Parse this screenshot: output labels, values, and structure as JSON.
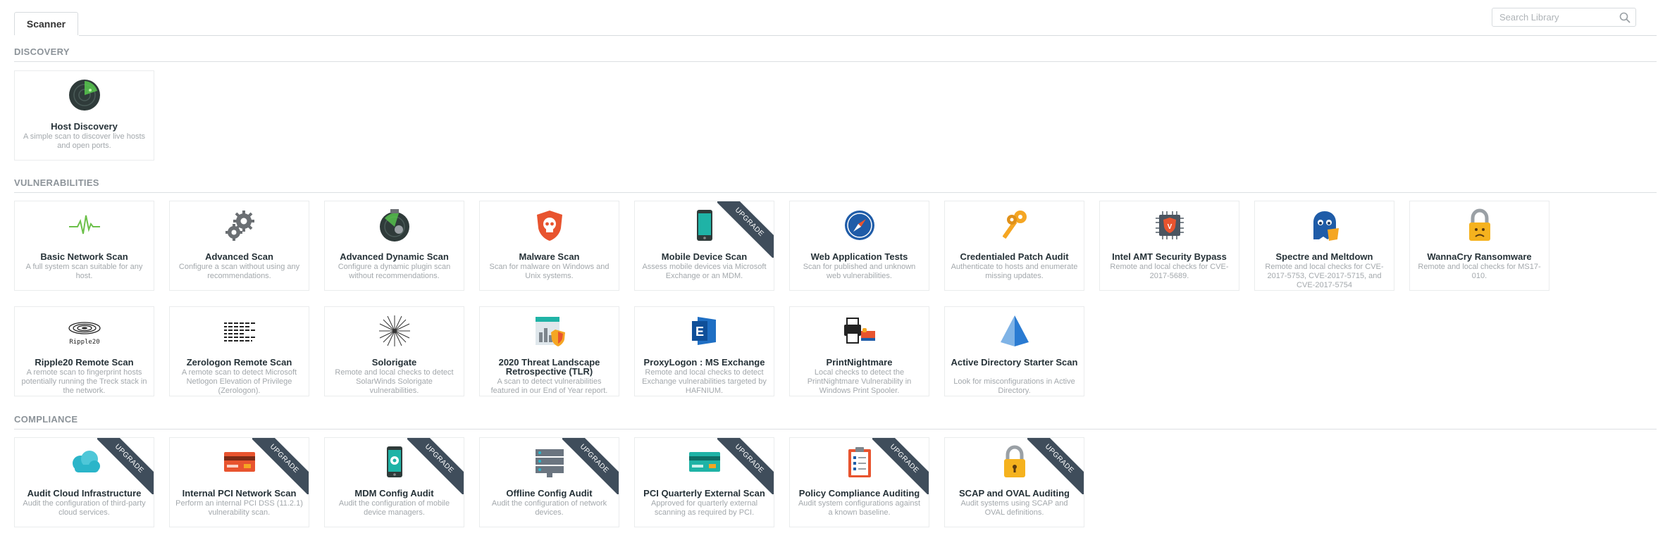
{
  "tabs": [
    {
      "label": "Scanner"
    }
  ],
  "search": {
    "placeholder": "Search Library"
  },
  "sections": {
    "discovery": "DISCOVERY",
    "vulnerabilities": "VULNERABILITIES",
    "compliance": "COMPLIANCE"
  },
  "upgrade_label": "UPGRADE",
  "cards": {
    "host_discovery": {
      "name": "Host Discovery",
      "desc": "A simple scan to discover live hosts and open ports.",
      "icon": "radar-icon"
    },
    "basic_network": {
      "name": "Basic Network Scan",
      "desc": "A full system scan suitable for any host.",
      "icon": "pulse-icon"
    },
    "advanced": {
      "name": "Advanced Scan",
      "desc": "Configure a scan without using any recommendations.",
      "icon": "gears-icon"
    },
    "advanced_dynamic": {
      "name": "Advanced Dynamic Scan",
      "desc": "Configure a dynamic plugin scan without recommendations.",
      "icon": "radar-gear-icon"
    },
    "malware": {
      "name": "Malware Scan",
      "desc": "Scan for malware on Windows and Unix systems.",
      "icon": "skull-shield-icon"
    },
    "mobile_device": {
      "name": "Mobile Device Scan",
      "desc": "Assess mobile devices via Microsoft Exchange or an MDM.",
      "icon": "phone-icon",
      "upgrade": true
    },
    "web_app": {
      "name": "Web Application Tests",
      "desc": "Scan for published and unknown web vulnerabilities.",
      "icon": "compass-icon"
    },
    "credentialed_patch": {
      "name": "Credentialed Patch Audit",
      "desc": "Authenticate to hosts and enumerate missing updates.",
      "icon": "keys-icon"
    },
    "intel_amt": {
      "name": "Intel AMT Security Bypass",
      "desc": "Remote and local checks for CVE-2017-5689.",
      "icon": "chip-icon"
    },
    "spectre": {
      "name": "Spectre and Meltdown",
      "desc": "Remote and local checks for CVE-2017-5753, CVE-2017-5715, and CVE-2017-5754",
      "icon": "ghost-icon"
    },
    "wannacry": {
      "name": "WannaCry Ransomware",
      "desc": "Remote and local checks for MS17-010.",
      "icon": "padlock-sad-icon"
    },
    "ripple20": {
      "name": "Ripple20 Remote Scan",
      "desc": "A remote scan to fingerprint hosts potentially running the Treck stack in the network.",
      "icon": "ripple20-logo-icon",
      "icon_text": "Ripple20"
    },
    "zerologon": {
      "name": "Zerologon Remote Scan",
      "desc": "A remote scan to detect Microsoft Netlogon Elevation of Privilege (Zerologon).",
      "icon": "zerologon-logo-icon"
    },
    "solorigate": {
      "name": "Solorigate",
      "desc": "Remote and local checks to detect SolarWinds Solorigate vulnerabilities.",
      "icon": "starburst-icon"
    },
    "tlr2020": {
      "name": "2020 Threat Landscape Retrospective (TLR)",
      "desc": "A scan to detect vulnerabilities featured in our End of Year report.",
      "icon": "report-shield-icon"
    },
    "proxylogon": {
      "name": "ProxyLogon : MS Exchange",
      "desc": "Remote and local checks to detect Exchange vulnerabilities targeted by HAFNIUM.",
      "icon": "exchange-icon"
    },
    "printnightmare": {
      "name": "PrintNightmare",
      "desc": "Local checks to detect the PrintNightmare Vulnerability in Windows Print Spooler.",
      "icon": "printer-bed-icon"
    },
    "active_directory": {
      "name": "Active Directory Starter Scan",
      "desc": "Look for misconfigurations in Active Directory.",
      "icon": "pyramid-icon"
    },
    "audit_cloud": {
      "name": "Audit Cloud Infrastructure",
      "desc": "Audit the configuration of third-party cloud services.",
      "icon": "cloud-icon",
      "upgrade": true
    },
    "internal_pci": {
      "name": "Internal PCI Network Scan",
      "desc": "Perform an internal PCI DSS (11.2.1) vulnerability scan.",
      "icon": "credit-card-icon",
      "upgrade": true
    },
    "mdm_config": {
      "name": "MDM Config Audit",
      "desc": "Audit the configuration of mobile device managers.",
      "icon": "phone-gear-icon",
      "upgrade": true
    },
    "offline_config": {
      "name": "Offline Config Audit",
      "desc": "Audit the configuration of network devices.",
      "icon": "server-icon",
      "upgrade": true
    },
    "pci_quarterly": {
      "name": "PCI Quarterly External Scan",
      "desc": "Approved for quarterly external scanning as required by PCI.",
      "icon": "credit-card-teal-icon",
      "upgrade": true
    },
    "policy_compliance": {
      "name": "Policy Compliance Auditing",
      "desc": "Audit system configurations against a known baseline.",
      "icon": "clipboard-icon",
      "upgrade": true
    },
    "scap_oval": {
      "name": "SCAP and OVAL Auditing",
      "desc": "Audit systems using SCAP and OVAL definitions.",
      "icon": "padlock-icon",
      "upgrade": true
    }
  },
  "colors": {
    "ribbon": "#3f4d5b",
    "section_text": "#8c9399",
    "card_title": "#263238",
    "card_desc": "#a3a8ac"
  }
}
